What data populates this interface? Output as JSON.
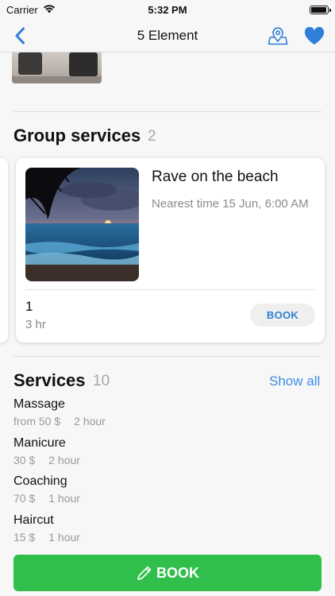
{
  "status_bar": {
    "carrier": "Carrier",
    "time": "5:32 PM",
    "battery_level": 0.95
  },
  "nav": {
    "title": "5 Element",
    "back_icon": "chevron-left-icon",
    "map_icon": "map-pin-icon",
    "favorite_icon": "heart-icon"
  },
  "group_services": {
    "title": "Group services",
    "count": "2",
    "card": {
      "title": "Rave on the beach",
      "nearest_time": "Nearest time 15 Jun, 6:00 AM",
      "quantity": "1",
      "duration": "3 hr",
      "book_label": "BOOK"
    }
  },
  "services": {
    "title": "Services",
    "count": "10",
    "show_all_label": "Show all",
    "items": [
      {
        "name": "Massage",
        "price": "from 50 $",
        "duration": "2 hour"
      },
      {
        "name": "Manicure",
        "price": "30 $",
        "duration": "2 hour"
      },
      {
        "name": "Coaching",
        "price": "70 $",
        "duration": "1 hour"
      },
      {
        "name": "Haircut",
        "price": "15 $",
        "duration": "1 hour"
      }
    ]
  },
  "footer": {
    "book_label": "BOOK"
  },
  "colors": {
    "accent_blue": "#2f7fd8",
    "book_green": "#2fbf4a",
    "muted_text": "#9a9a9a"
  }
}
